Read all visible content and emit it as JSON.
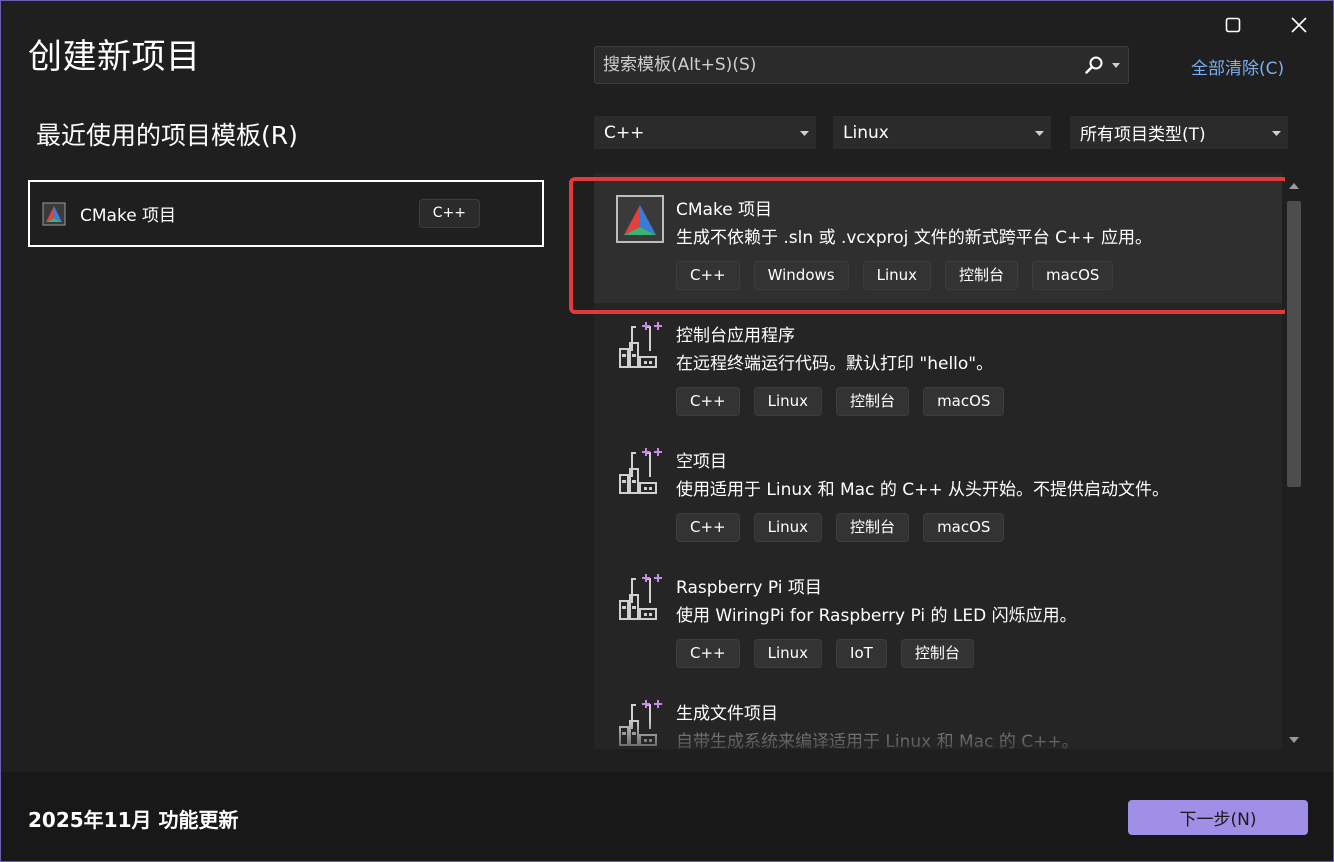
{
  "window": {
    "title": "创建新项目",
    "maximize_icon": "maximize-icon",
    "close_icon": "close-icon"
  },
  "recent": {
    "heading": "最近使用的项目模板(R)",
    "items": [
      {
        "name": "CMake 项目",
        "tag": "C++",
        "icon": "cmake-icon"
      }
    ]
  },
  "search": {
    "placeholder": "搜索模板(Alt+S)(S)",
    "icon": "search-icon"
  },
  "clear_all": "全部清除(C)",
  "filters": {
    "language": "C++",
    "platform": "Linux",
    "project_type": "所有项目类型(T)"
  },
  "templates": [
    {
      "name": "CMake 项目",
      "description": "生成不依赖于 .sln 或 .vcxproj 文件的新式跨平台 C++ 应用。",
      "tags": [
        "C++",
        "Windows",
        "Linux",
        "控制台",
        "macOS"
      ],
      "icon": "cmake-icon",
      "selected": true
    },
    {
      "name": "控制台应用程序",
      "description": "在远程终端运行代码。默认打印 \"hello\"。",
      "tags": [
        "C++",
        "Linux",
        "控制台",
        "macOS"
      ],
      "icon": "linux-cpp-project-icon"
    },
    {
      "name": "空项目",
      "description": "使用适用于 Linux 和 Mac 的 C++ 从头开始。不提供启动文件。",
      "tags": [
        "C++",
        "Linux",
        "控制台",
        "macOS"
      ],
      "icon": "linux-cpp-project-icon"
    },
    {
      "name": "Raspberry Pi 项目",
      "description": "使用 WiringPi for Raspberry Pi 的 LED 闪烁应用。",
      "tags": [
        "C++",
        "Linux",
        "IoT",
        "控制台"
      ],
      "icon": "linux-cpp-project-icon"
    },
    {
      "name": "生成文件项目",
      "description": "自带生成系统来编译适用于 Linux 和 Mac 的 C++。",
      "tags": [],
      "icon": "linux-cpp-project-icon"
    }
  ],
  "footer": {
    "label": "2025年11月 功能更新",
    "next_button": "下一步(N)"
  },
  "colors": {
    "background": "#1f1f1f",
    "accent_button": "#a08fe6",
    "link": "#7aaef0",
    "highlight": "#e03a3a",
    "window_border": "#6b5fb0"
  }
}
